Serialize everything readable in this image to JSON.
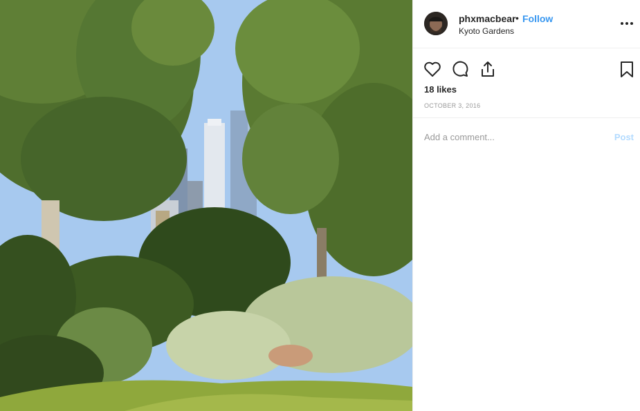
{
  "photo": {
    "alt_icon": "photo-image",
    "colors": {
      "sky": "#a7c9ef",
      "foliage_dark": "#3a5520",
      "foliage_light": "#8fae55",
      "building": "#dbe3ec"
    }
  },
  "header": {
    "username": "phxmacbear",
    "separator": "•",
    "follow_label": "Follow",
    "location": "Kyoto Gardens",
    "more_icon": "more-horizontal-icon"
  },
  "actions": {
    "like_icon": "heart-icon",
    "comment_icon": "comment-icon",
    "share_icon": "share-icon",
    "save_icon": "bookmark-icon"
  },
  "likes_text": "18 likes",
  "date_text": "OCTOBER 3, 2016",
  "comment": {
    "placeholder": "Add a comment...",
    "value": "",
    "post_label": "Post"
  },
  "colors": {
    "accent": "#3897f0",
    "post_disabled": "#b3dbff",
    "text": "#262626",
    "muted": "#999999"
  }
}
